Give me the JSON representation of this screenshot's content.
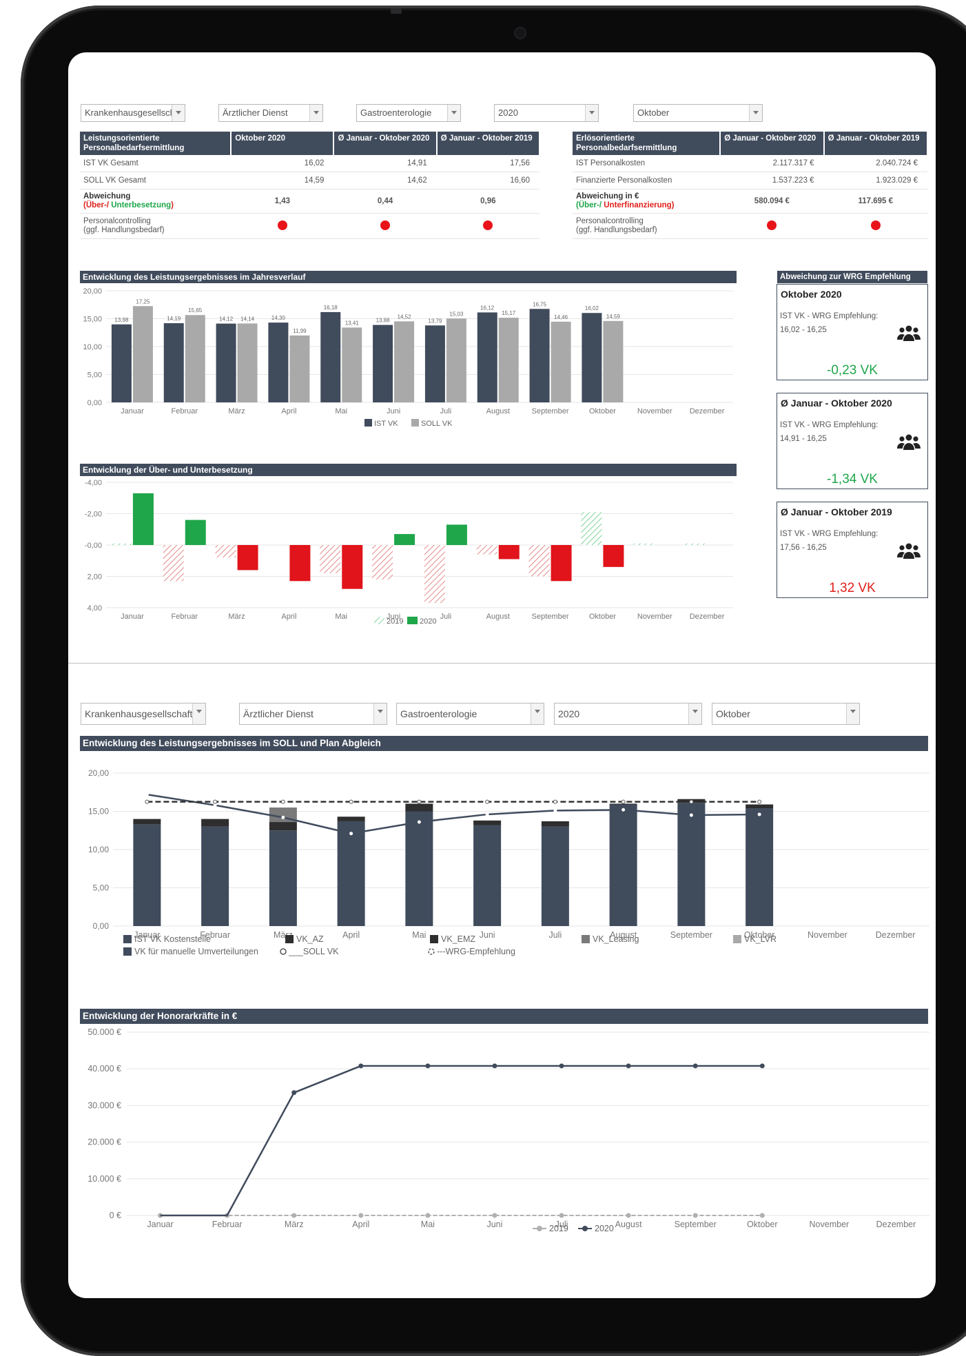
{
  "filters_top": [
    "Krankenhausgesellschaft",
    "Ärztlicher Dienst",
    "Gastroenterologie",
    "2020",
    "Oktober"
  ],
  "filters_bottom": [
    "Krankenhausgesellschaft",
    "Ärztlicher Dienst",
    "Gastroenterologie",
    "2020",
    "Oktober"
  ],
  "table_left": {
    "headers": [
      "Leistungsorientierte Personalbedarfsermittlung",
      "Oktober 2020",
      "Ø Januar - Oktober 2020",
      "Ø Januar - Oktober 2019"
    ],
    "rows": [
      {
        "label": "IST VK Gesamt",
        "v": [
          "16,02",
          "14,91",
          "17,56"
        ]
      },
      {
        "label": "SOLL VK Gesamt",
        "v": [
          "14,59",
          "14,62",
          "16,60"
        ]
      }
    ],
    "abw_label": "Abweichung",
    "abw_sub_a": "(Über-/ ",
    "abw_sub_b": "Unterbesetzung",
    ")": ")",
    "abw_values": [
      "1,43",
      "0,44",
      "0,96"
    ],
    "ctrl_label": "Personalcontrolling",
    "ctrl_sub": "(ggf. Handlungsbedarf)"
  },
  "table_right": {
    "headers": [
      "Erlösorientierte Personalbedarfsermittlung",
      "Ø Januar - Oktober 2020",
      "Ø Januar - Oktober 2019"
    ],
    "rows": [
      {
        "label": "IST Personalkosten",
        "v": [
          "2.117.317 €",
          "2.040.724 €"
        ]
      },
      {
        "label": "Finanzierte Personalkosten",
        "v": [
          "1.537.223 €",
          "1.923.029 €"
        ]
      }
    ],
    "abw_label": "Abweichung in €",
    "abw_sub_a": "(Über-/ ",
    "abw_sub_b": "Unterfinanzierung",
    "abw_values": [
      "580.094 €",
      "117.695 €"
    ],
    "ctrl_label": "Personalcontrolling",
    "ctrl_sub": "(ggf. Handlungsbedarf)"
  },
  "sections": {
    "s1": "Entwicklung des Leistungsergebnisses im Jahresverlauf",
    "s2": "Entwicklung der Über- und Unterbesetzung",
    "s3": "Abweichung zur WRG Empfehlung",
    "s4": "Entwicklung des Leistungsergebnisses im SOLL und Plan Abgleich",
    "s5": "Entwicklung der Honorarkräfte in €"
  },
  "cards": [
    {
      "title": "Oktober 2020",
      "label": "IST VK - WRG Empfehlung:",
      "range": "16,02 - 16,25",
      "value": "-0,23 VK",
      "color": "#1fa64a"
    },
    {
      "title": "Ø Januar - Oktober 2020",
      "label": "IST VK - WRG Empfehlung:",
      "range": "14,91 - 16,25",
      "value": "-1,34 VK",
      "color": "#1fa64a"
    },
    {
      "title": "Ø Januar - Oktober 2019",
      "label": "IST VK - WRG Empfehlung:",
      "range": "17,56 - 16,25",
      "value": "1,32 VK",
      "color": "#e0201b"
    }
  ],
  "chart_data": [
    {
      "type": "bar",
      "categories": [
        "Januar",
        "Februar",
        "März",
        "April",
        "Mai",
        "Juni",
        "Juli",
        "August",
        "September",
        "Oktober",
        "November",
        "Dezember"
      ],
      "series": [
        {
          "name": "IST VK",
          "values": [
            13.98,
            14.19,
            14.12,
            14.3,
            16.18,
            13.88,
            13.79,
            16.12,
            16.75,
            16.02,
            null,
            null
          ],
          "color": "#404b5c"
        },
        {
          "name": "SOLL VK",
          "values": [
            17.25,
            15.65,
            14.14,
            11.99,
            13.41,
            14.52,
            15.03,
            15.17,
            14.46,
            14.59,
            null,
            null
          ],
          "color": "#a9a9a9"
        }
      ],
      "labels_ist": [
        "13,98",
        "14,19",
        "14,12",
        "14,30",
        "16,18",
        "13,88",
        "13,79",
        "16,12",
        "16,75",
        "16,02"
      ],
      "labels_soll": [
        "17,25",
        "15,65",
        "14,14",
        "11,99",
        "13,41",
        "14,52",
        "15,03",
        "15,17",
        "14,46",
        "14,59"
      ],
      "ylim": [
        0,
        20
      ],
      "yticks": [
        "0,00",
        "5,00",
        "10,00",
        "15,00",
        "20,00"
      ]
    },
    {
      "type": "bar",
      "categories": [
        "Januar",
        "Februar",
        "März",
        "April",
        "Mai",
        "Juni",
        "Juli",
        "August",
        "September",
        "Oktober",
        "November",
        "Dezember"
      ],
      "series": [
        {
          "name": "2019",
          "values": [
            -0.1,
            2.3,
            0.8,
            null,
            1.8,
            2.2,
            3.7,
            0.6,
            2.0,
            -2.1,
            -0.1,
            -0.1
          ],
          "color": "#e07a7a"
        },
        {
          "name": "2020",
          "values": [
            -3.3,
            -1.6,
            1.6,
            2.3,
            2.8,
            -0.7,
            -1.3,
            0.9,
            2.3,
            1.4,
            null,
            null
          ],
          "color": "#1fa64a"
        }
      ],
      "yticks": [
        "-4,00",
        "-2,00",
        "-0,00",
        "2,00",
        "4,00"
      ],
      "ylim": [
        -4,
        4
      ]
    },
    {
      "type": "bar",
      "categories": [
        "Januar",
        "Februar",
        "März",
        "April",
        "Mai",
        "Juni",
        "Juli",
        "August",
        "September",
        "Oktober",
        "November",
        "Dezember"
      ],
      "series": [
        {
          "name": "IST VK Kostenstelle",
          "values": [
            13.3,
            13.0,
            12.5,
            13.7,
            15.0,
            13.2,
            13.0,
            15.9,
            16.1,
            15.4,
            null,
            null
          ],
          "color": "#404b5c"
        },
        {
          "name": "VK_AZ",
          "values": [
            0.7,
            1.0,
            1.1,
            0.6,
            1.0,
            0.6,
            0.7,
            0.1,
            0.5,
            0.5,
            null,
            null
          ],
          "color": "#2e2e2e"
        },
        {
          "name": "VK_Leasing",
          "values": [
            0,
            0,
            1.9,
            0,
            0,
            0,
            0,
            0,
            0,
            0,
            null,
            null
          ],
          "color": "#7a7a7a"
        },
        {
          "name": "SOLL VK",
          "values": [
            17.2,
            15.8,
            14.2,
            12.1,
            13.6,
            14.6,
            15.1,
            15.2,
            14.5,
            14.6,
            null,
            null
          ]
        },
        {
          "name": "WRG-Empfehlung",
          "values": [
            16.25,
            16.25,
            16.25,
            16.25,
            16.25,
            16.25,
            16.25,
            16.25,
            16.25,
            16.25,
            null,
            null
          ]
        }
      ],
      "legend": [
        "IST VK Kostenstelle",
        "VK_AZ",
        "VK_EMZ",
        "VK_Leasing",
        "VK_LVR",
        "VK für manuelle Umverteilungen",
        "SOLL VK",
        "WRG-Empfehlung"
      ],
      "legend_prefix_soll": "___",
      "legend_prefix_wrg": "---",
      "ylim": [
        0,
        20
      ],
      "yticks": [
        "0,00",
        "5,00",
        "10,00",
        "15,00",
        "20,00"
      ]
    },
    {
      "type": "line",
      "categories": [
        "Januar",
        "Februar",
        "März",
        "April",
        "Mai",
        "Juni",
        "Juli",
        "August",
        "September",
        "Oktober",
        "November",
        "Dezember"
      ],
      "series": [
        {
          "name": "2019",
          "values": [
            0,
            0,
            0,
            0,
            0,
            0,
            0,
            0,
            0,
            0,
            null,
            null
          ],
          "color": "#b0b0b0"
        },
        {
          "name": "2020",
          "values": [
            0,
            0,
            33500,
            40800,
            40800,
            40800,
            40800,
            40800,
            40800,
            40800,
            null,
            null
          ],
          "color": "#404b5c"
        }
      ],
      "ylim": [
        0,
        50000
      ],
      "yticks": [
        "0 €",
        "10.000 €",
        "20.000 €",
        "30.000 €",
        "40.000 €",
        "50.000 €"
      ]
    }
  ]
}
